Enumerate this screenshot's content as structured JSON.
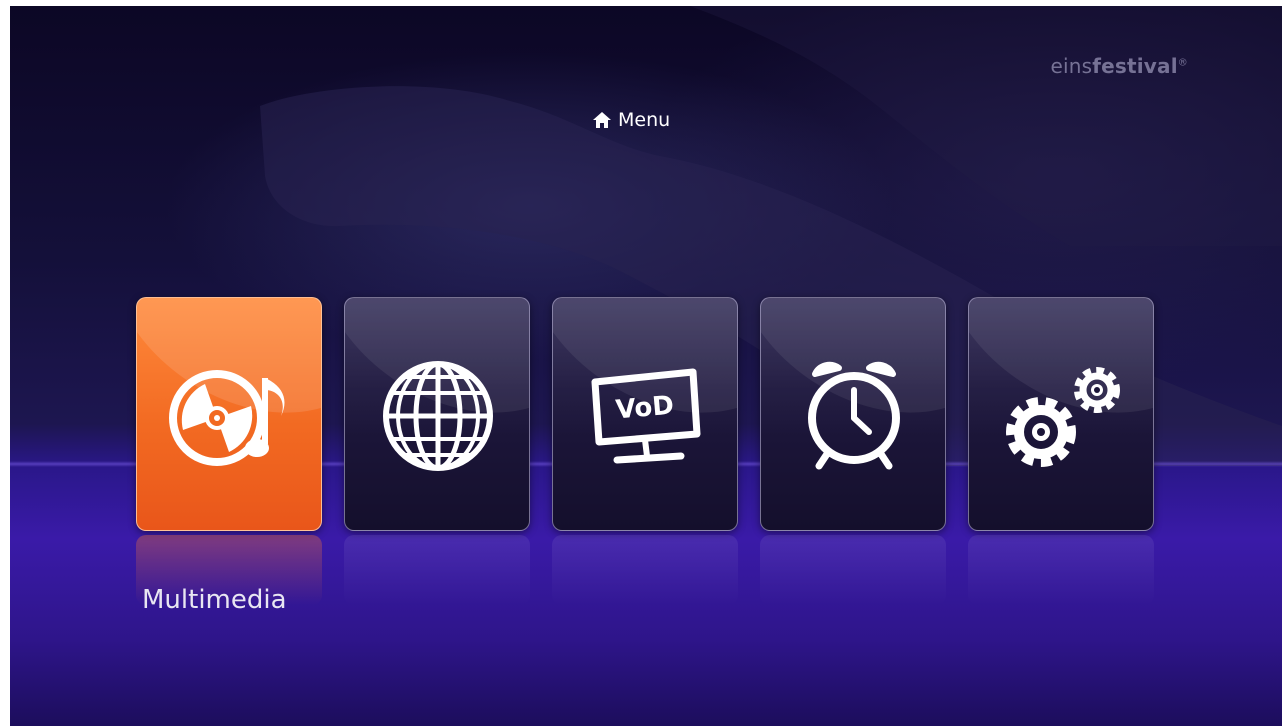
{
  "header": {
    "title": "Menu",
    "brand": {
      "part1": "eins",
      "part2": "festival",
      "mark": "®"
    }
  },
  "menu": {
    "items": [
      {
        "label": "Multimedia",
        "icon": "multimedia-icon",
        "selected": true
      },
      {
        "label": "",
        "icon": "globe-icon",
        "selected": false
      },
      {
        "label": "VoD",
        "icon": "vod-tv-icon",
        "selected": false
      },
      {
        "label": "",
        "icon": "alarm-clock-icon",
        "selected": false
      },
      {
        "label": "",
        "icon": "gears-icon",
        "selected": false
      }
    ],
    "selected_label": "Multimedia"
  },
  "colors": {
    "accent": "#f26a22",
    "tile_bg": "#1b1538",
    "text": "#ffffff"
  }
}
